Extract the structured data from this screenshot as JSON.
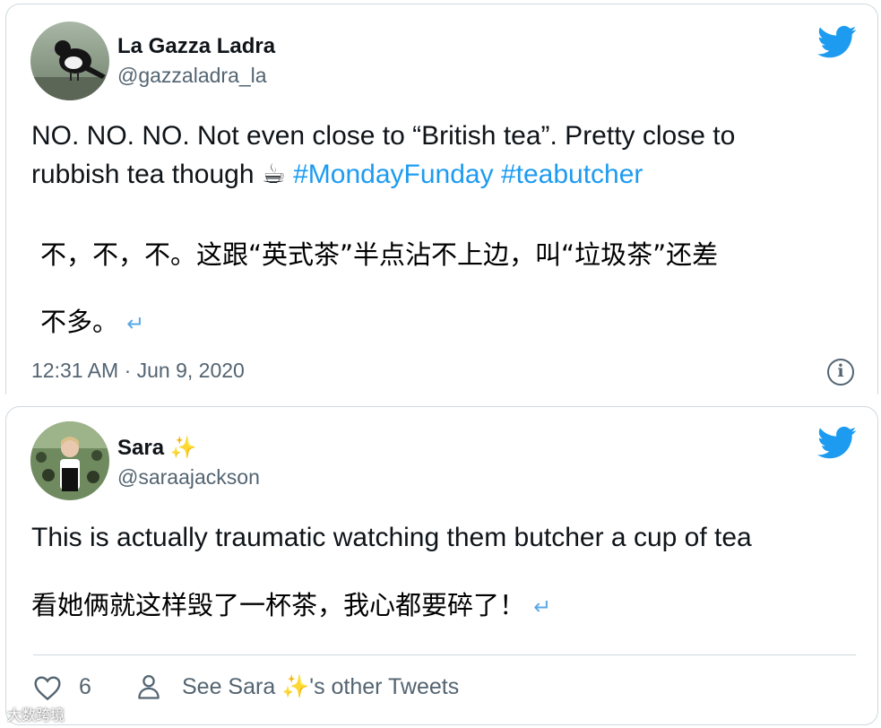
{
  "tweet1": {
    "display_name": "La Gazza Ladra",
    "handle": "@gazzaladra_la",
    "text_line1": "NO. NO. NO. Not even close to “British tea”. Pretty close to",
    "text_line2": "rubbish tea though ☕",
    "hashtag1": "#MondayFunday",
    "hashtag2": "#teabutcher",
    "translation_line1": "不，不，不。这跟“英式茶”半点沾不上边，叫“垃圾茶”还差",
    "translation_line2": "不多。",
    "return_mark": "↵",
    "timestamp": "12:31 AM · Jun 9, 2020",
    "info_icon": "i"
  },
  "tweet2": {
    "display_name": "Sara ✨",
    "handle": "@saraajackson",
    "text": "This is actually traumatic watching them butcher a cup of tea",
    "translation": "看她俩就这样毁了一杯茶，我心都要碎了！",
    "return_mark": "↵",
    "like_count": "6",
    "see_other": "See Sara ✨'s other Tweets"
  },
  "watermark": "大数跨境",
  "colors": {
    "twitter_blue": "#1d9bf0",
    "secondary_text": "#536471",
    "border": "#cfd9de"
  },
  "icons": {
    "brand": "twitter-bird-icon",
    "like": "heart-icon",
    "profile": "person-icon",
    "info": "info-icon"
  }
}
